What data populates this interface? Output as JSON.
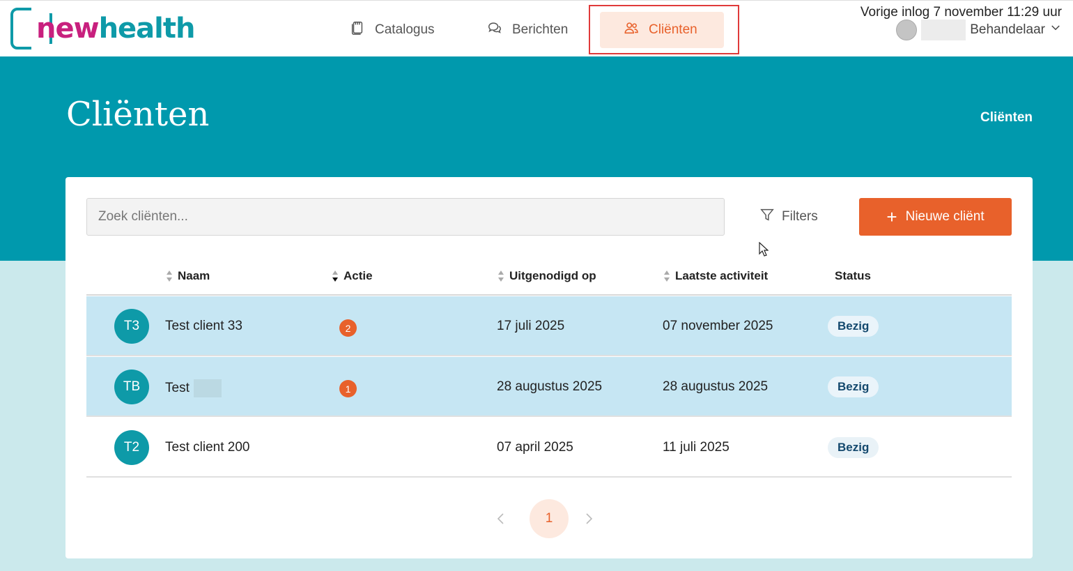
{
  "brand": {
    "logo_new": "new",
    "logo_health": "health"
  },
  "nav": {
    "items": [
      {
        "label": "Catalogus",
        "icon": "catalog-icon"
      },
      {
        "label": "Berichten",
        "icon": "chat-icon"
      },
      {
        "label": "Cliënten",
        "icon": "users-icon",
        "active": true
      }
    ]
  },
  "user": {
    "last_login": "Vorige inlog 7 november 11:29 uur",
    "role": "Behandelaar"
  },
  "header": {
    "title": "Cliënten",
    "breadcrumb": "Cliënten"
  },
  "toolbar": {
    "search_placeholder": "Zoek cliënten...",
    "filters_label": "Filters",
    "new_client_label": "Nieuwe cliënt"
  },
  "table": {
    "columns": [
      "Naam",
      "Actie",
      "Uitgenodigd op",
      "Laatste activiteit",
      "Status"
    ],
    "rows": [
      {
        "initials": "T3",
        "name": "Test client 33",
        "action_count": "2",
        "invited": "17 juli 2025",
        "last_activity": "07 november 2025",
        "status": "Bezig",
        "selected": true
      },
      {
        "initials": "TB",
        "name": "Test",
        "action_count": "1",
        "invited": "28 augustus 2025",
        "last_activity": "28 augustus 2025",
        "status": "Bezig",
        "selected": true
      },
      {
        "initials": "T2",
        "name": "Test client 200",
        "action_count": "",
        "invited": "07 april 2025",
        "last_activity": "11 juli 2025",
        "status": "Bezig",
        "selected": false
      }
    ]
  },
  "pagination": {
    "current": "1"
  },
  "colors": {
    "accent": "#e8612b",
    "teal": "#0099ad",
    "brand_magenta": "#c8207e",
    "brand_teal": "#0e9aa8",
    "row_selected": "#c6e6f3"
  }
}
